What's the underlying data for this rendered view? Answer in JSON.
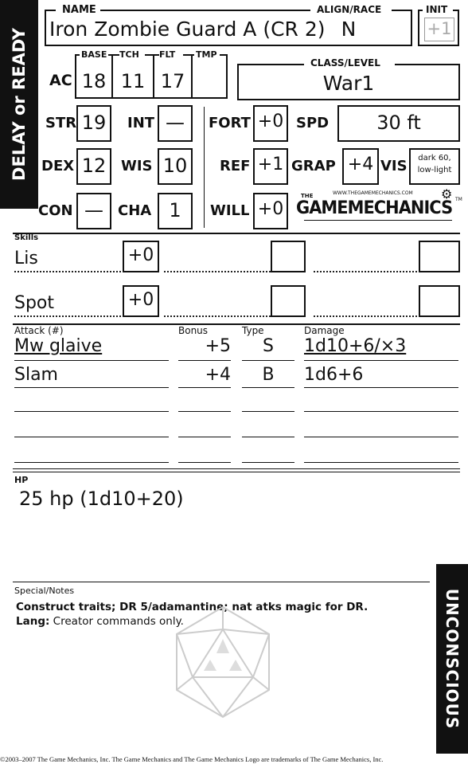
{
  "sidebar": {
    "delay_label": "DELAY or READY",
    "unconscious_label": "UNCONSCIOUS"
  },
  "header": {
    "name_label": "NAME",
    "name_value": "Iron Zombie Guard A (CR 2)",
    "align_label": "ALIGN/RACE",
    "align_value": "N",
    "init_label": "INIT",
    "init_value": "+1"
  },
  "ac": {
    "label": "AC",
    "base_label": "BASE",
    "base_value": "18",
    "tch_label": "TCH",
    "tch_value": "11",
    "flt_label": "FLT",
    "flt_value": "17",
    "tmp_label": "TMP",
    "tmp_value": ""
  },
  "class": {
    "label": "CLASS/LEVEL",
    "value": "War1"
  },
  "abilities": {
    "str_label": "STR",
    "str_value": "19",
    "int_label": "INT",
    "int_value": "—",
    "dex_label": "DEX",
    "dex_value": "12",
    "wis_label": "WIS",
    "wis_value": "10",
    "con_label": "CON",
    "con_value": "—",
    "cha_label": "CHA",
    "cha_value": "1"
  },
  "saves": {
    "fort_label": "FORT",
    "fort_value": "+0",
    "ref_label": "REF",
    "ref_value": "+1",
    "will_label": "WILL",
    "will_value": "+0"
  },
  "misc": {
    "spd_label": "SPD",
    "spd_value": "30 ft",
    "grap_label": "GRAP",
    "grap_value": "+4",
    "vis_label": "VIS",
    "vis_line1": "dark 60,",
    "vis_line2": "low-light"
  },
  "logo": {
    "url_text": "WWW.THEGAMEMECHANICS.COM",
    "the": "THE",
    "name": "GAMEMECHANICS",
    "tm": "TM"
  },
  "skills": {
    "label": "Skills",
    "rows": [
      {
        "name": "Lis",
        "value": "+0"
      },
      {
        "name": "Spot",
        "value": "+0"
      }
    ]
  },
  "attacks": {
    "attack_label": "Attack (#)",
    "bonus_label": "Bonus",
    "type_label": "Type",
    "damage_label": "Damage",
    "rows": [
      {
        "name": "Mw glaive",
        "bonus": "+5",
        "type": "S",
        "damage": "1d10+6/×3"
      },
      {
        "name": "Slam",
        "bonus": "+4",
        "type": "B",
        "damage": "1d6+6"
      }
    ]
  },
  "hp": {
    "label": "HP",
    "value": "25 hp (1d10+20)"
  },
  "notes": {
    "label": "Special/Notes",
    "line1": "Construct traits; DR 5/adamantine; nat atks magic for DR.",
    "lang_label": "Lang:",
    "lang_value": " Creator commands only."
  },
  "footer": {
    "copyright": "©2003–2007 The Game Mechanics, Inc. The Game Mechanics and The Game Mechanics Logo are trademarks of The Game Mechanics, Inc."
  }
}
